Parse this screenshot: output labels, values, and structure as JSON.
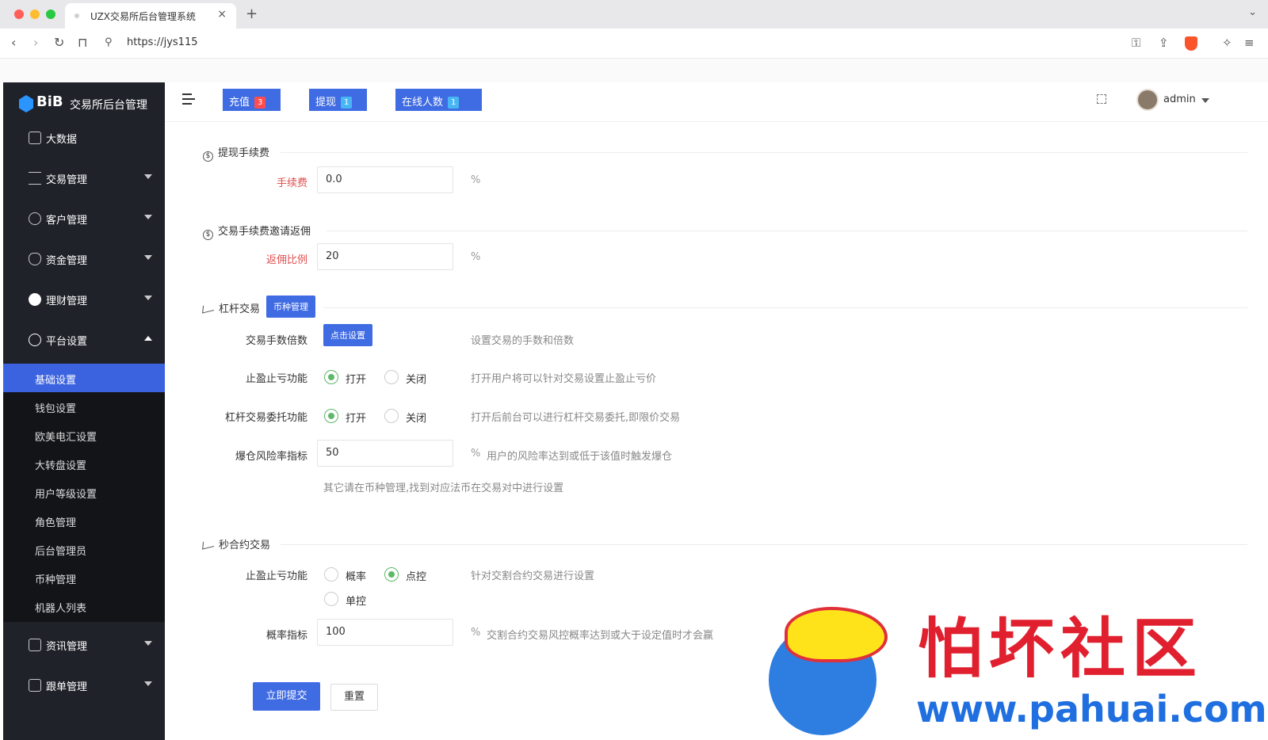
{
  "browser": {
    "tab_title": "UZX交易所后台管理系统",
    "url": "https://jys115"
  },
  "sidebar": {
    "logo_text": "BiB",
    "logo_sub": "交易所后台管理",
    "items": [
      {
        "label": "大数据"
      },
      {
        "label": "交易管理"
      },
      {
        "label": "客户管理"
      },
      {
        "label": "资金管理"
      },
      {
        "label": "理财管理"
      },
      {
        "label": "平台设置"
      },
      {
        "label": "资讯管理"
      },
      {
        "label": "跟单管理"
      }
    ],
    "submenu": [
      {
        "label": "基础设置"
      },
      {
        "label": "钱包设置"
      },
      {
        "label": "欧美电汇设置"
      },
      {
        "label": "大转盘设置"
      },
      {
        "label": "用户等级设置"
      },
      {
        "label": "角色管理"
      },
      {
        "label": "后台管理员"
      },
      {
        "label": "币种管理"
      },
      {
        "label": "机器人列表"
      }
    ]
  },
  "header": {
    "recharge": {
      "label": "充值",
      "count": "3"
    },
    "withdraw": {
      "label": "提现",
      "count": "1"
    },
    "online": {
      "label": "在线人数",
      "count": "1"
    },
    "user": "admin"
  },
  "form": {
    "withdraw_fee": {
      "title": "提现手续费",
      "label": "手续费",
      "value": "0.0",
      "unit": "%"
    },
    "rebate": {
      "title": "交易手续费邀请返佣",
      "label": "返佣比例",
      "value": "20",
      "unit": "%"
    },
    "leverage": {
      "title": "杠杆交易",
      "coin_btn": "币种管理",
      "multiplier_label": "交易手数倍数",
      "multiplier_btn": "点击设置",
      "multiplier_hint": "设置交易的手数和倍数",
      "stop_label": "止盈止亏功能",
      "open": "打开",
      "close": "关闭",
      "stop_hint": "打开用户将可以针对交易设置止盈止亏价",
      "entrust_label": "杠杆交易委托功能",
      "entrust_hint": "打开后前台可以进行杠杆交易委托,即限价交易",
      "risk_label": "爆仓风险率指标",
      "risk_value": "50",
      "risk_unit": "%",
      "risk_hint": "用户的风险率达到或低于该值时触发爆仓",
      "note": "其它请在币种管理,找到对应法币在交易对中进行设置"
    },
    "seconds": {
      "title": "秒合约交易",
      "stop_label": "止盈止亏功能",
      "opt_prob": "概率",
      "opt_point": "点控",
      "opt_single": "单控",
      "stop_hint": "针对交割合约交易进行设置",
      "prob_label": "概率指标",
      "prob_value": "100",
      "prob_unit": "%",
      "prob_hint": "交割合约交易风控概率达到或大于设定值时才会赢"
    },
    "submit": "立即提交",
    "reset": "重置"
  },
  "watermark": {
    "cn": "怕坏社区",
    "url": "www.pahuai.com"
  }
}
